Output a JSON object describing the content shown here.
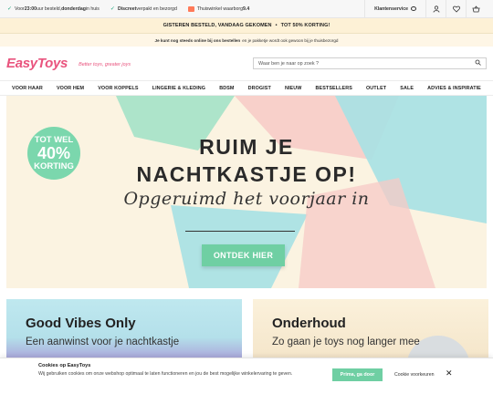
{
  "usps": [
    {
      "pre": "Voor ",
      "bold": "23:00",
      "mid": " uur besteld, ",
      "bold2": "donderdag",
      "post": " in huis"
    },
    {
      "pre": "",
      "bold": "Discreet",
      "mid": " verpakt en bezorgd",
      "bold2": "",
      "post": ""
    },
    {
      "pre": "Thuiswinkel waarborg ",
      "bold": "9.4",
      "mid": "",
      "bold2": "",
      "post": ""
    }
  ],
  "top_right": {
    "service_label": "Klantenservice"
  },
  "promo": {
    "part1": "GISTEREN BESTELD, VANDAAG GEKOMEN",
    "dot": "•",
    "part2": "TOT 50% KORTING!"
  },
  "info": {
    "bold": "Je kunt nog steeds online bij ons bestellen",
    "rest": "en je pakketje wordt ook gewoon bij je thuisbezorgd"
  },
  "logo": {
    "text": "EasyToys",
    "tagline": "Better toys, greater joys"
  },
  "search": {
    "placeholder": "Waar ben je naar op zoek ?"
  },
  "nav": [
    "VOOR HAAR",
    "VOOR HEM",
    "VOOR KOPPELS",
    "LINGERIE & KLEDING",
    "BDSM",
    "DROGIST",
    "NIEUW",
    "BESTSELLERS",
    "OUTLET",
    "SALE",
    "ADVIES & INSPIRATIE"
  ],
  "hero": {
    "badge": {
      "l1": "TOT WEL",
      "l2": "40%",
      "l3": "KORTING"
    },
    "title1": "RUIM JE",
    "title2": "NACHTKASTJE OP!",
    "subtitle": "Opgeruimd het voorjaar in",
    "cta": "ONTDEK HIER"
  },
  "cards": [
    {
      "title": "Good Vibes Only",
      "subtitle": "Een aanwinst voor je nachtkastje"
    },
    {
      "title": "Onderhoud",
      "subtitle": "Zo gaan je toys nog langer mee"
    }
  ],
  "cookie": {
    "title": "Cookies op EasyToys",
    "text": "Wij gebruiken cookies om onze webshop optimaal te laten functioneren en jou de best mogelijke winkelervaring te geven.",
    "accept": "Prima, ga door",
    "prefs": "Cookie voorkeuren",
    "close": "✕"
  },
  "colors": {
    "brand": "#e9547e",
    "accent": "#6fcfa3"
  }
}
